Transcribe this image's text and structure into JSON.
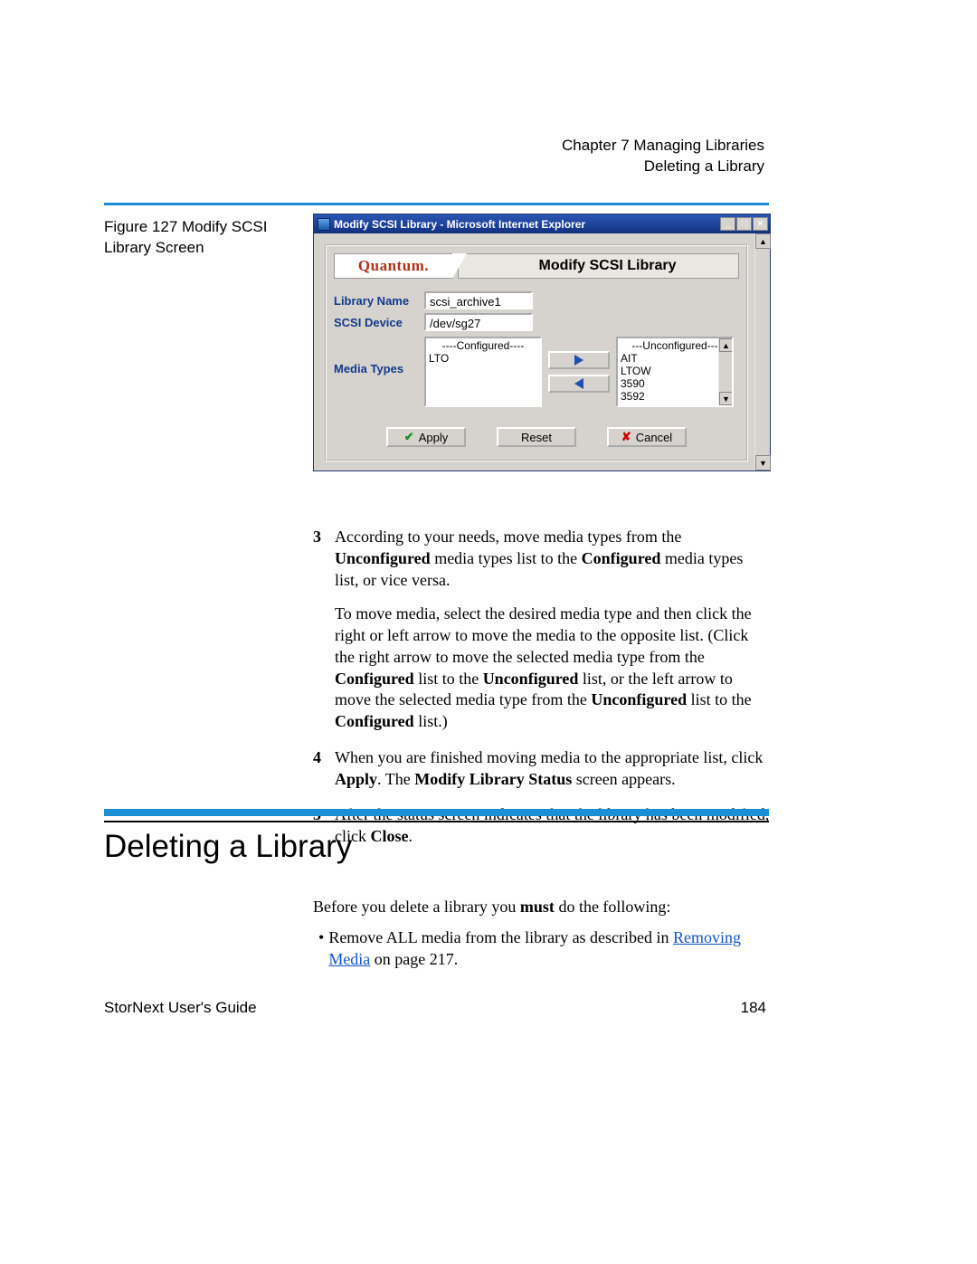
{
  "header": {
    "chapter": "Chapter 7  Managing Libraries",
    "section": "Deleting a Library"
  },
  "figure_caption": "Figure 127  Modify SCSI Library Screen",
  "dialog": {
    "window_title": "Modify SCSI Library - Microsoft Internet Explorer",
    "brand": "Quantum.",
    "panel_title": "Modify SCSI Library",
    "labels": {
      "library_name": "Library Name",
      "scsi_device": "SCSI Device",
      "media_types": "Media Types"
    },
    "values": {
      "library_name": "scsi_archive1",
      "scsi_device": "/dev/sg27"
    },
    "configured_header": "----Configured----",
    "unconfigured_header": "---Unconfigured---",
    "configured_items": [
      "LTO"
    ],
    "unconfigured_items": [
      "AIT",
      "LTOW",
      "3590",
      "3592"
    ],
    "buttons": {
      "apply": "Apply",
      "reset": "Reset",
      "cancel": "Cancel"
    }
  },
  "steps": {
    "s3a_pre": "According to your needs, move media types from the ",
    "s3a_b1": "Unconfigured",
    "s3a_mid": " media types list to the ",
    "s3a_b2": "Configured",
    "s3a_post": " media types list, or vice versa.",
    "s3b_pre": "To move media, select the desired media type and then click the right or left arrow to move the media to the opposite list. (Click the right arrow to move the selected media type from the ",
    "s3b_b1": "Configured",
    "s3b_mid1": " list to the ",
    "s3b_b2": "Unconfigured",
    "s3b_mid2": " list, or the left arrow to move the selected media type from the ",
    "s3b_b3": "Unconfigured",
    "s3b_mid3": " list to the ",
    "s3b_b4": "Configured",
    "s3b_post": " list.)",
    "s4_pre": "When you are finished moving media to the appropriate list, click ",
    "s4_b1": "Apply",
    "s4_mid": ". The ",
    "s4_b2": "Modify Library Status",
    "s4_post": " screen appears.",
    "s5_pre": "After the status screen indicates that the library has been modified, click ",
    "s5_b1": "Close",
    "s5_post": "."
  },
  "section2": {
    "title": "Deleting a Library",
    "intro_pre": "Before you delete a library you ",
    "intro_b": "must",
    "intro_post": " do the following:",
    "bullet_pre": "Remove ALL media from the library as described in ",
    "bullet_link": "Removing Media",
    "bullet_post": " on page  217."
  },
  "footer": {
    "left": "StorNext User's Guide",
    "right": "184"
  }
}
